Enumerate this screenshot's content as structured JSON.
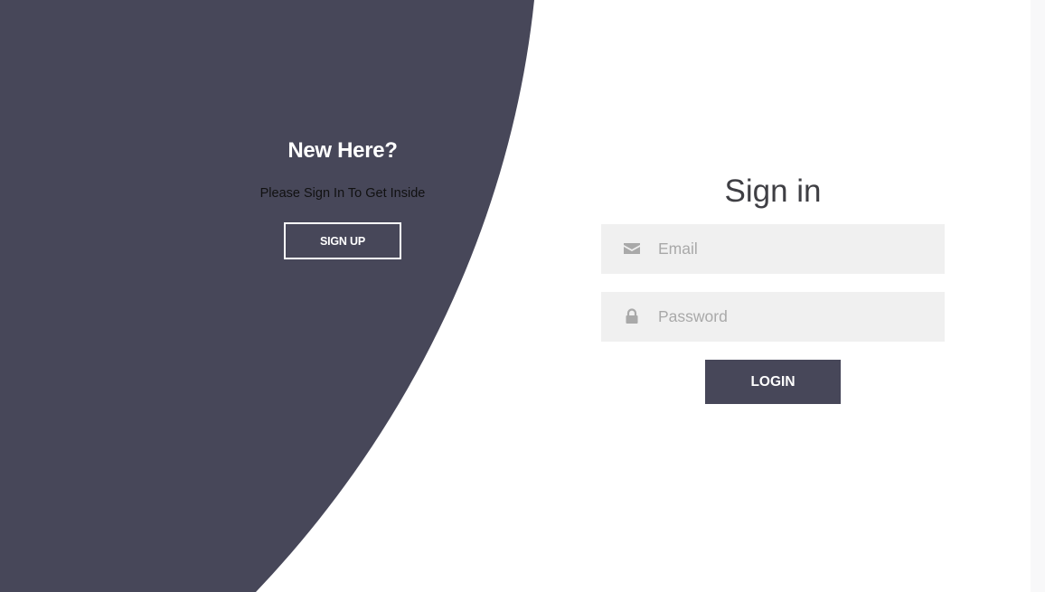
{
  "colors": {
    "panel": "#474759",
    "field_bg": "#f0f0f0",
    "accent": "#474759",
    "title_text": "#3f3f44",
    "icon": "#a9a9a9"
  },
  "left_panel": {
    "title": "New Here?",
    "text": "Please Sign In To Get Inside",
    "signup_label": "SIGN UP"
  },
  "form": {
    "title": "Sign in",
    "email": {
      "placeholder": "Email",
      "value": "",
      "icon": "envelope-icon"
    },
    "password": {
      "placeholder": "Password",
      "value": "",
      "icon": "lock-icon"
    },
    "login_label": "LOGIN"
  }
}
